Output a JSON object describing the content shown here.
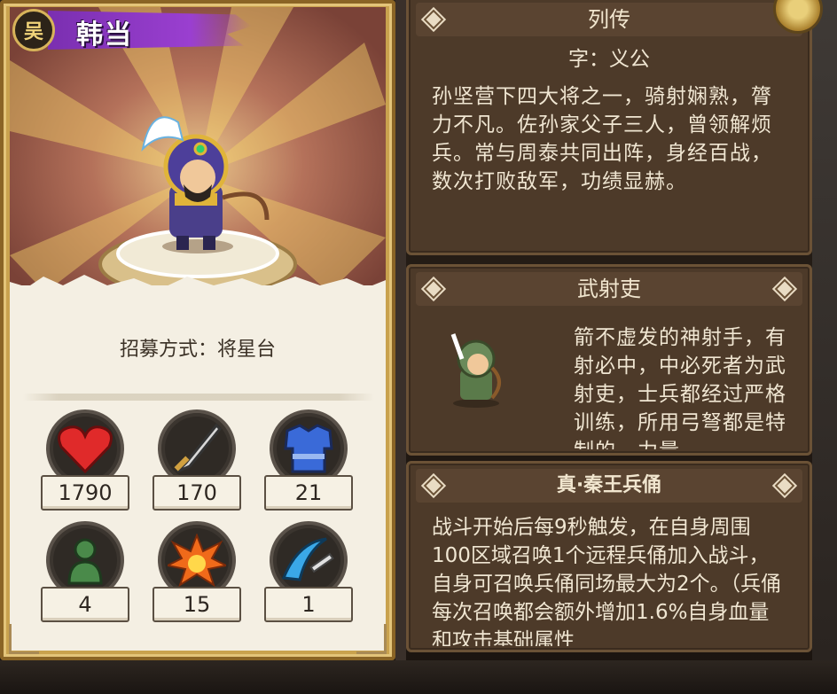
{
  "hero": {
    "faction": "吴",
    "name": "韩当",
    "recruit_method": "招募方式：将星台"
  },
  "stats": [
    {
      "icon": "heart-icon",
      "value": "1790"
    },
    {
      "icon": "sword-icon",
      "value": "170"
    },
    {
      "icon": "armor-icon",
      "value": "21"
    },
    {
      "icon": "troops-icon",
      "value": "4"
    },
    {
      "icon": "explosion-icon",
      "value": "15"
    },
    {
      "icon": "swift-blade-icon",
      "value": "1"
    }
  ],
  "biography": {
    "title": "列传",
    "courtesy_name": "字：义公",
    "text": "孙坚营下四大将之一，骑射娴熟，膂力不凡。佐孙家父子三人，曾领解烦兵。常与周泰共同出阵，身经百战，数次打败敌军，功绩显赫。"
  },
  "unit": {
    "title": "武射吏",
    "text": "箭不虚发的神射手，有射必中，中必死者为武射吏，士兵都经过严格训练，所用弓弩都是特制的，力量"
  },
  "skill": {
    "title": "真·秦王兵俑",
    "text": "战斗开始后每9秒触发，在自身周围100区域召唤1个远程兵俑加入战斗，自身可召唤兵俑同场最大为2个。（兵俑每次召唤都会额外增加1.6%自身血量和攻击基础属性"
  },
  "colors": {
    "faction_banner": "#9a3fd0",
    "panel_bg": "#4d3a29",
    "card_gold": "#c9a24e"
  }
}
